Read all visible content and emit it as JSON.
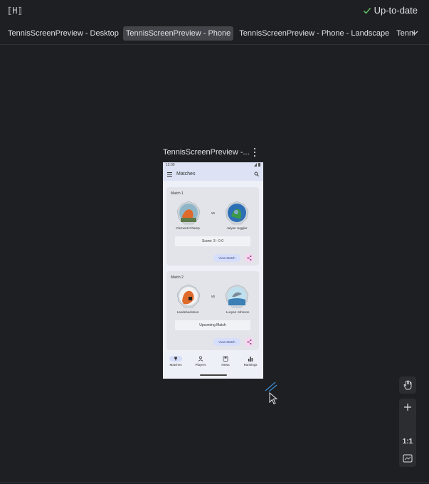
{
  "window": {
    "app_icon_text": "⟦H⟧",
    "status_text": "Up-to-date"
  },
  "tabs": [
    {
      "label": "TennisScreenPreview - Desktop",
      "selected": false
    },
    {
      "label": "TennisScreenPreview - Phone",
      "selected": true
    },
    {
      "label": "TennisScreenPreview - Phone - Landscape",
      "selected": false
    },
    {
      "label": "Tenni",
      "selected": false
    }
  ],
  "preview": {
    "title": "TennisScreenPreview -..."
  },
  "phone": {
    "status_time": "12:00",
    "app_title": "Matches",
    "matches": [
      {
        "label": "Match 1",
        "player1": "Clementi Champ",
        "player2": "Julyan Juggler",
        "vs": "vs",
        "result": "Score: 3 - 0 0",
        "view_label": "View Match"
      },
      {
        "label": "Match 2",
        "player1": "Landebeelotion",
        "player2": "Lucyan Johnson",
        "vs": "vs",
        "result": "Upcoming Match",
        "view_label": "View Match"
      }
    ],
    "nav": [
      {
        "label": "Matches",
        "icon": "trophy-icon",
        "active": true
      },
      {
        "label": "Players",
        "icon": "person-icon",
        "active": false
      },
      {
        "label": "News",
        "icon": "news-icon",
        "active": false
      },
      {
        "label": "Rankings",
        "icon": "bar-chart-icon",
        "active": false
      }
    ]
  },
  "tools": {
    "zoom_label": "1:1"
  },
  "colors": {
    "background": "#1e1f22",
    "accent_green": "#5fb865",
    "selected_tab": "#43454a"
  }
}
